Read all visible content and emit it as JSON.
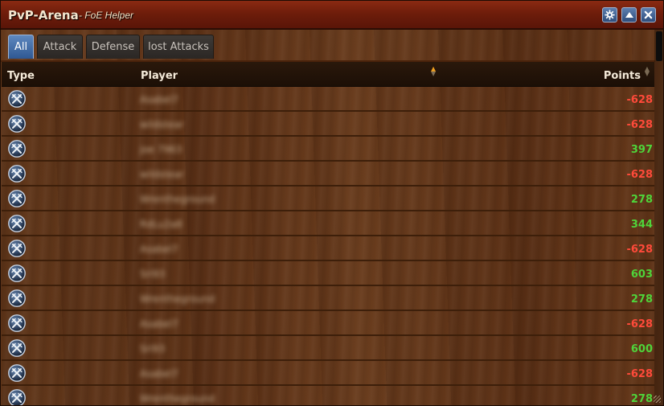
{
  "window": {
    "title": "PvP-Arena",
    "subtitle": "- FoE Helper",
    "buttons": [
      {
        "name": "settings-button",
        "icon": "gear-icon"
      },
      {
        "name": "minimize-button",
        "icon": "chevron-up-icon"
      },
      {
        "name": "close-button",
        "icon": "close-icon"
      }
    ]
  },
  "tabs": [
    {
      "label": "All",
      "active": true
    },
    {
      "label": "Attack",
      "active": false
    },
    {
      "label": "Defense",
      "active": false
    },
    {
      "label": "lost Attacks",
      "active": false
    }
  ],
  "table": {
    "columns": {
      "type": "Type",
      "player": "Player",
      "points": "Points"
    },
    "rows": [
      {
        "type_icon": "swords-icon",
        "player": "Asabel7",
        "points": "-628",
        "sign": "neg"
      },
      {
        "type_icon": "swords-icon",
        "player": "wildstear",
        "points": "-628",
        "sign": "neg"
      },
      {
        "type_icon": "swords-icon",
        "player": "joe 7963",
        "points": "397",
        "sign": "pos"
      },
      {
        "type_icon": "swords-icon",
        "player": "wildstear",
        "points": "-628",
        "sign": "neg"
      },
      {
        "type_icon": "swords-icon",
        "player": "Wrentheground",
        "points": "278",
        "sign": "pos"
      },
      {
        "type_icon": "swords-icon",
        "player": "RdLu2a8",
        "points": "344",
        "sign": "pos"
      },
      {
        "type_icon": "swords-icon",
        "player": "Asabel7",
        "points": "-628",
        "sign": "neg"
      },
      {
        "type_icon": "swords-icon",
        "player": "Sri93",
        "points": "603",
        "sign": "pos"
      },
      {
        "type_icon": "swords-icon",
        "player": "Wrentheground",
        "points": "278",
        "sign": "pos"
      },
      {
        "type_icon": "swords-icon",
        "player": "Asabel7",
        "points": "-628",
        "sign": "neg"
      },
      {
        "type_icon": "swords-icon",
        "player": "Sri93",
        "points": "600",
        "sign": "pos"
      },
      {
        "type_icon": "swords-icon",
        "player": "Asabel7",
        "points": "-628",
        "sign": "neg"
      },
      {
        "type_icon": "swords-icon",
        "player": "Wrentheground",
        "points": "278",
        "sign": "pos"
      }
    ]
  },
  "colors": {
    "negative": "#ff4a3a",
    "positive": "#4fd43a",
    "active_tab": "#4a73aa",
    "title_bar": "#7a2410"
  }
}
